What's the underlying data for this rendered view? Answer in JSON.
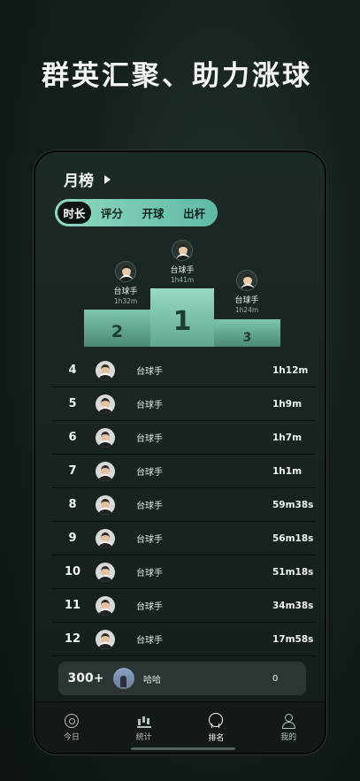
{
  "headline": "群英汇聚、助力涨球",
  "board": {
    "title": "月榜"
  },
  "tabs": [
    {
      "label": "时长",
      "active": true
    },
    {
      "label": "评分",
      "active": false
    },
    {
      "label": "开球",
      "active": false
    },
    {
      "label": "出杆",
      "active": false
    }
  ],
  "podium": {
    "first": {
      "rank": "1",
      "name": "台球手",
      "duration": "1h41m"
    },
    "second": {
      "rank": "2",
      "name": "台球手",
      "duration": "1h32m"
    },
    "third": {
      "rank": "3",
      "name": "台球手",
      "duration": "1h24m"
    }
  },
  "rows": [
    {
      "rank": "4",
      "name": "台球手",
      "duration": "1h12m"
    },
    {
      "rank": "5",
      "name": "台球手",
      "duration": "1h9m"
    },
    {
      "rank": "6",
      "name": "台球手",
      "duration": "1h7m"
    },
    {
      "rank": "7",
      "name": "台球手",
      "duration": "1h1m"
    },
    {
      "rank": "8",
      "name": "台球手",
      "duration": "59m38s"
    },
    {
      "rank": "9",
      "name": "台球手",
      "duration": "56m18s"
    },
    {
      "rank": "10",
      "name": "台球手",
      "duration": "51m18s"
    },
    {
      "rank": "11",
      "name": "台球手",
      "duration": "34m38s"
    },
    {
      "rank": "12",
      "name": "台球手",
      "duration": "17m58s"
    }
  ],
  "me": {
    "rank": "300+",
    "name": "哈哈",
    "duration": "0"
  },
  "tabbar": [
    {
      "label": "今日",
      "icon": "record-icon",
      "active": false
    },
    {
      "label": "统计",
      "icon": "bar-chart-icon",
      "active": false
    },
    {
      "label": "排名",
      "icon": "medal-icon",
      "active": true
    },
    {
      "label": "我的",
      "icon": "user-icon",
      "active": false
    }
  ]
}
